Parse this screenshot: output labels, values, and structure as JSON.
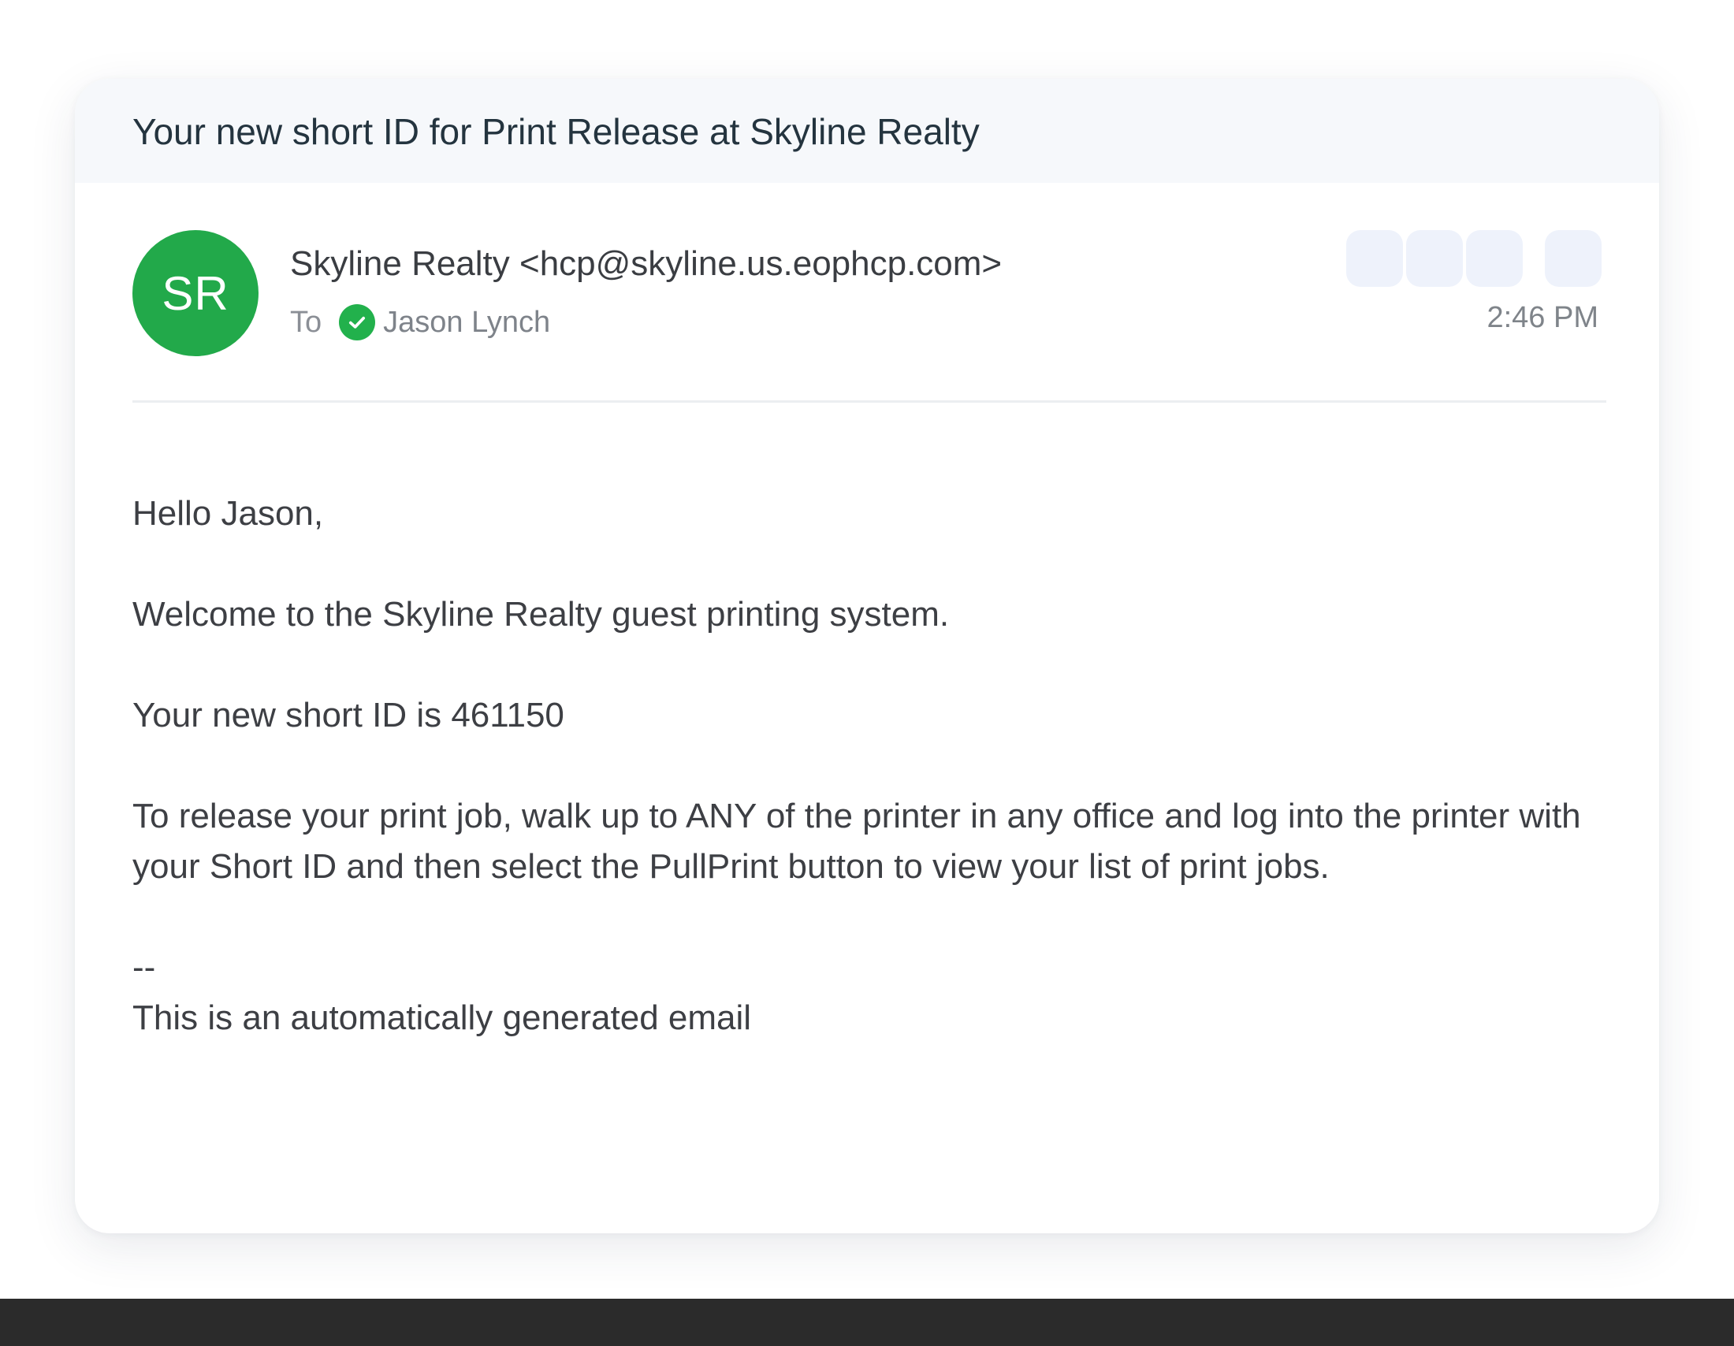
{
  "email": {
    "subject": "Your new short ID for Print Release at Skyline Realty",
    "avatar_initials": "SR",
    "sender": "Skyline Realty <hcp@skyline.us.eophcp.com>",
    "to_label": "To",
    "recipient": "Jason Lynch",
    "time": "2:46 PM",
    "body": {
      "greeting": "Hello Jason,",
      "welcome": "Welcome to the Skyline Realty guest printing system.",
      "short_id_line": "Your new short ID is 461150",
      "instructions": "To release your print job, walk up to ANY of the printer in any office and log into the printer with your Short ID and then select the PullPrint button to view your list of print jobs.",
      "signature_separator": "--",
      "footer": "This is an automatically generated email"
    }
  },
  "colors": {
    "avatar": "#22a94a",
    "verified_check": "#22b14c",
    "subject_bar": "#f6f8fb",
    "action_button": "#eef2fb"
  },
  "icons": {
    "verified": "check-circle-icon"
  }
}
